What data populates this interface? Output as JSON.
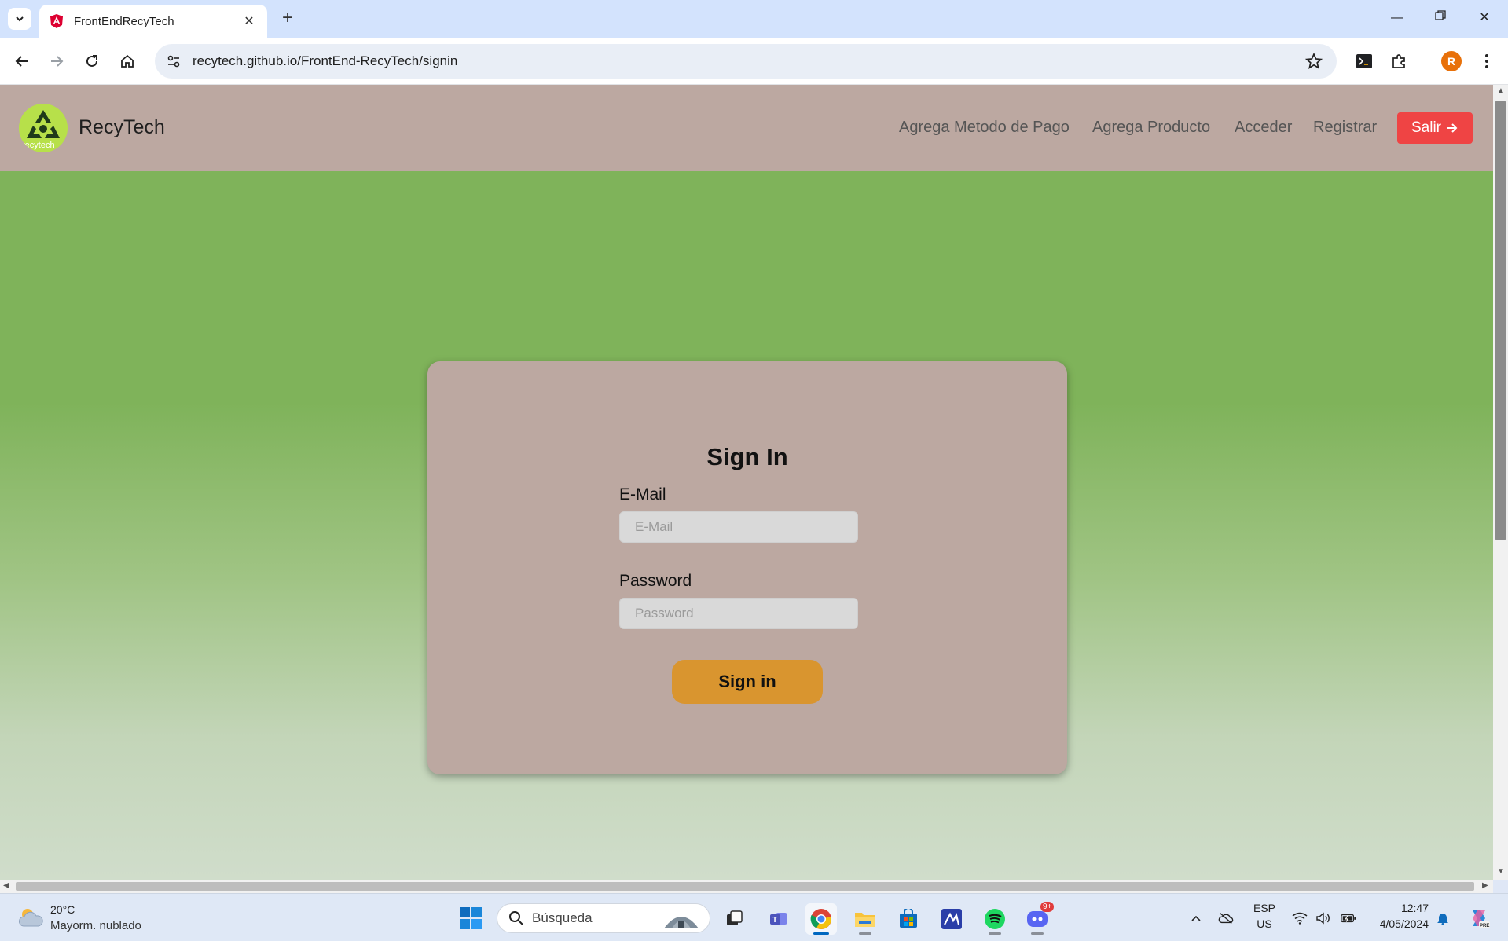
{
  "browser": {
    "tab_title": "FrontEndRecyTech",
    "url": "recytech.github.io/FrontEnd-RecyTech/signin",
    "profile_initial": "R"
  },
  "site": {
    "brand": "RecyTech",
    "logo_text": "recytech",
    "nav": {
      "payment": "Agrega Metodo de Pago",
      "product": "Agrega Producto",
      "access": "Acceder",
      "register": "Registrar",
      "logout": "Salir"
    }
  },
  "signin": {
    "title": "Sign In",
    "email_label": "E-Mail",
    "email_placeholder": "E-Mail",
    "email_value": "",
    "password_label": "Password",
    "password_placeholder": "Password",
    "password_value": "",
    "submit": "Sign in"
  },
  "taskbar": {
    "temp": "20°C",
    "weather": "Mayorm. nublado",
    "search_placeholder": "Búsqueda",
    "discord_badge": "9+",
    "lang": "ESP",
    "region": "US",
    "time": "12:47",
    "date": "4/05/2024"
  },
  "colors": {
    "page_green": "#7fb35a",
    "navbar": "#bca8a1",
    "card": "#bca8a1",
    "salir": "#ef4444",
    "signin_button": "#d9952f"
  }
}
